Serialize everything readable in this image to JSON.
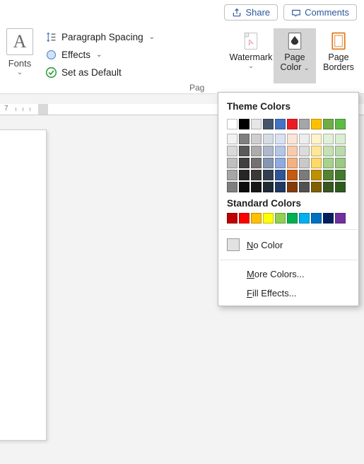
{
  "title_buttons": {
    "share": "Share",
    "comments": "Comments"
  },
  "ribbon": {
    "fonts_label": "Fonts",
    "formatting": {
      "paragraph_spacing": "Paragraph Spacing",
      "effects": "Effects",
      "set_default": "Set as Default"
    },
    "page_bg": {
      "watermark": "Watermark",
      "page_color": {
        "line1": "Page",
        "line2": "Color"
      },
      "page_borders": {
        "line1": "Page",
        "line2": "Borders"
      },
      "group_label_partial": "Pag"
    }
  },
  "ruler": {
    "number": "7"
  },
  "dropdown": {
    "theme_header": "Theme Colors",
    "standard_header": "Standard Colors",
    "no_color": {
      "pre": "N",
      "rest": "o Color"
    },
    "more_colors": {
      "pre": "M",
      "rest": "ore Colors..."
    },
    "fill_effects": {
      "pre": "F",
      "rest": "ill Effects..."
    },
    "theme_row": [
      "#ffffff",
      "#000000",
      "#e7e6e6",
      "#44546a",
      "#4472c4",
      "#ed1c24",
      "#a6a6a6",
      "#ffc000",
      "#70ad47",
      "#5dbb46"
    ],
    "theme_shades": [
      [
        "#f2f2f2",
        "#808080",
        "#d0cece",
        "#d6dce5",
        "#d9e1f2",
        "#fbe5d6",
        "#ededed",
        "#fff2cc",
        "#e2f0d9",
        "#dbeed4"
      ],
      [
        "#d9d9d9",
        "#595959",
        "#aeabab",
        "#adb9ca",
        "#b4c6e7",
        "#f8cbad",
        "#dbdbdb",
        "#ffe699",
        "#c5e0b4",
        "#badaad"
      ],
      [
        "#bfbfbf",
        "#404040",
        "#757171",
        "#8497b0",
        "#8faadc",
        "#f4b183",
        "#c9c9c9",
        "#ffd966",
        "#a9d18e",
        "#9ac885"
      ],
      [
        "#a6a6a6",
        "#262626",
        "#3b3838",
        "#333f50",
        "#2f5597",
        "#c55a11",
        "#7b7b7b",
        "#bf9000",
        "#548235",
        "#447a2e"
      ],
      [
        "#7f7f7f",
        "#0d0d0d",
        "#171717",
        "#222a35",
        "#1f3864",
        "#843c0c",
        "#525252",
        "#806000",
        "#385723",
        "#2f5b1f"
      ]
    ],
    "standard_row": [
      "#c00000",
      "#ff0000",
      "#ffc000",
      "#ffff00",
      "#92d050",
      "#00b050",
      "#00b0f0",
      "#0070c0",
      "#002060",
      "#7030a0"
    ]
  }
}
